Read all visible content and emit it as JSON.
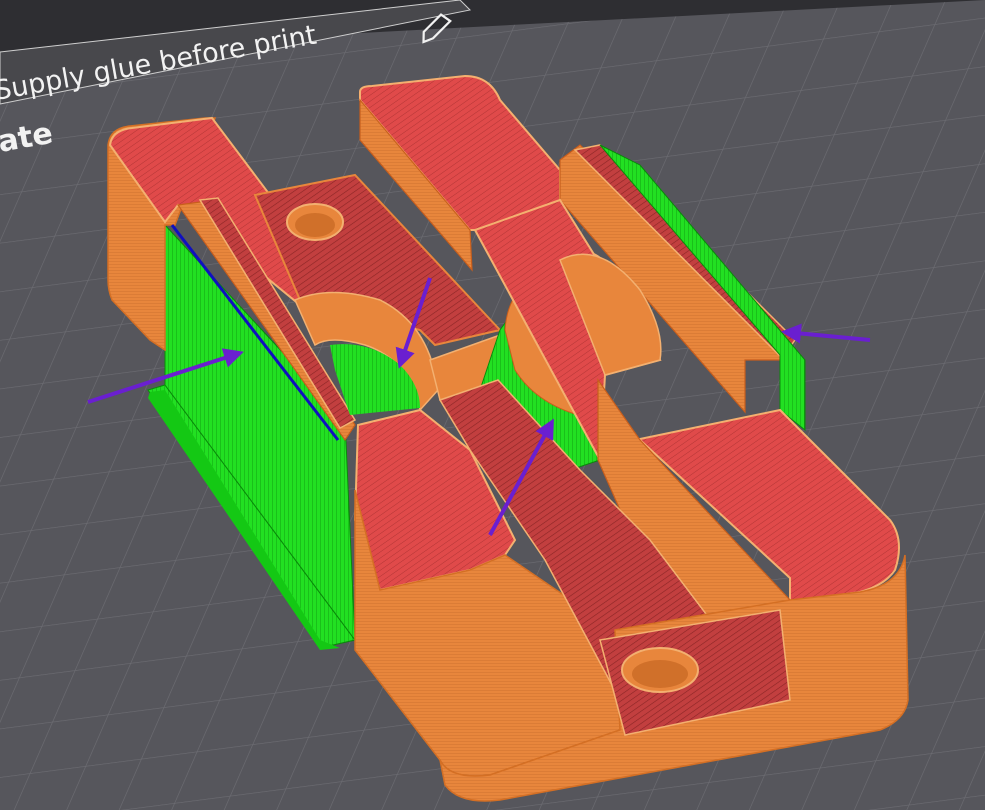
{
  "viewport": {
    "plate_notice": "Supply glue before print",
    "plate_label_fragment": "ate",
    "edit_icon": "pencil-icon"
  },
  "colors": {
    "background": "#56565c",
    "grid": "#6b6b70",
    "outer_wall": "#e8863c",
    "top_surface": "#e04848",
    "support": "#19e019",
    "bottom_surface": "#b83838",
    "bridge_wall": "#f0a060",
    "annotation_arrow": "#6a1fd0"
  },
  "annotations": {
    "arrow_count": 4,
    "targets": [
      "left-rail-overhang",
      "left-arch-overhang",
      "center-arch-overhang",
      "right-rail-overhang"
    ]
  }
}
